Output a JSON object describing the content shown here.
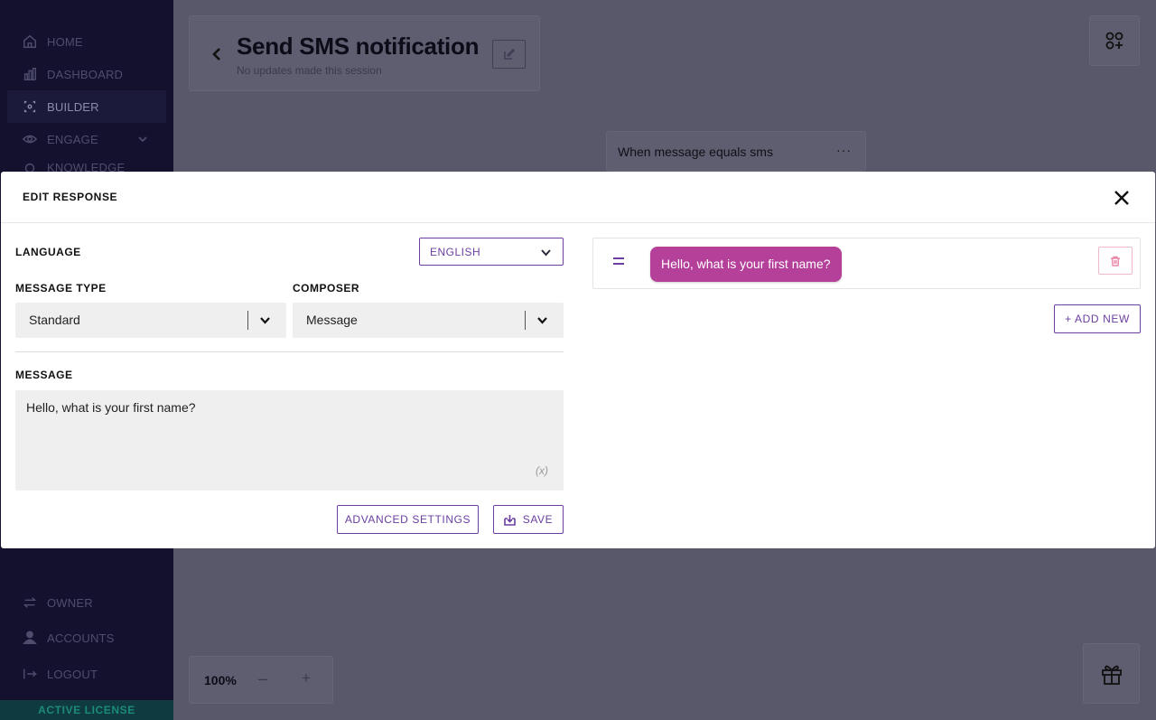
{
  "sidebar": {
    "items": [
      {
        "label": "HOME",
        "icon": "home-icon"
      },
      {
        "label": "DASHBOARD",
        "icon": "chart-icon"
      },
      {
        "label": "BUILDER",
        "icon": "builder-icon"
      },
      {
        "label": "ENGAGE",
        "icon": "eye-icon"
      },
      {
        "label": "KNOWLEDGE",
        "icon": "bulb-icon"
      },
      {
        "label": "OWNER",
        "icon": "swap-icon"
      },
      {
        "label": "ACCOUNTS",
        "icon": "user-icon"
      },
      {
        "label": "LOGOUT",
        "icon": "logout-icon"
      }
    ],
    "license": "ACTIVE LICENSE"
  },
  "header": {
    "title": "Send SMS notification",
    "subtitle": "No updates made this session"
  },
  "flow": {
    "node_label": "When message equals sms",
    "node_menu": "···"
  },
  "zoom": {
    "value": "100%",
    "out": "–",
    "in": "+"
  },
  "modal": {
    "title": "EDIT RESPONSE",
    "language_label": "LANGUAGE",
    "language_value": "ENGLISH",
    "message_type_label": "MESSAGE TYPE",
    "message_type_value": "Standard",
    "composer_label": "COMPOSER",
    "composer_value": "Message",
    "message_label": "MESSAGE",
    "message_text": "Hello, what is your first name?",
    "variable_icon": "(x)",
    "advanced_settings": "ADVANCED SETTINGS",
    "save": "SAVE",
    "preview_bubble": "Hello, what is your first name?",
    "add_new": "+ ADD NEW"
  },
  "colors": {
    "accent": "#6b3fa0",
    "bubble": "#b5409a",
    "sidebar": "#13112e",
    "license": "#1b8a7a"
  }
}
